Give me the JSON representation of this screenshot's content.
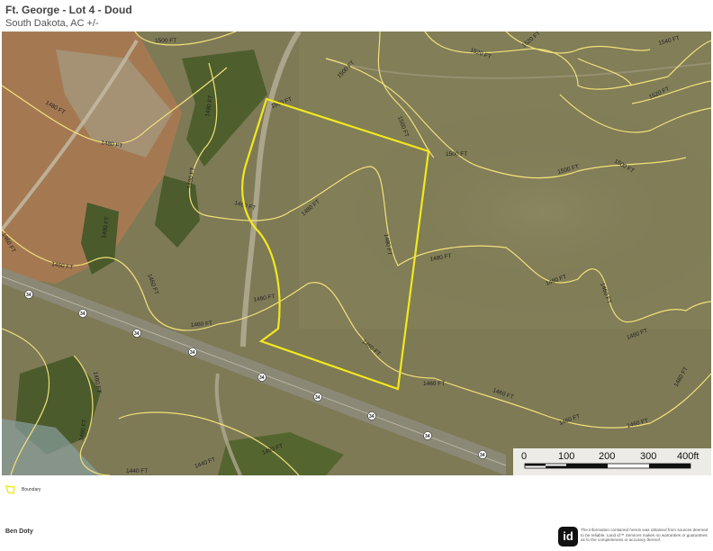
{
  "header": {
    "title": "Ft. George - Lot 4 - Doud",
    "subtitle": "South Dakota,  AC +/-"
  },
  "map": {
    "highway_number": "34",
    "contour_labels": [
      "1500 FT",
      "1500 FT",
      "1540 FT",
      "1520 FT",
      "1520 FT",
      "1520 FT",
      "1480 FT",
      "1480 FT",
      "1500 FT",
      "1500 FT",
      "1480 FT",
      "1500 FT",
      "1500 FT",
      "1500 FT",
      "1480 FT",
      "1460 FT",
      "1480 FT",
      "1460 FT",
      "1480 FT",
      "1480 FT",
      "1460 FT",
      "1480 FT",
      "1460 FT",
      "1460 FT",
      "1480 FT",
      "1460 FT",
      "1460 FT",
      "1480 FT",
      "1460 FT",
      "1460 FT",
      "1460 FT",
      "1460 FT",
      "1460 FT",
      "1440 FT",
      "1440 FT",
      "1460 FT",
      "1460 FT",
      "1460 FT",
      "1460 FT"
    ],
    "colors": {
      "boundary": "#f2e81e",
      "contour": "#f2e17a",
      "imagery": "#7d7a55"
    },
    "scale": {
      "labels": [
        "0",
        "100",
        "200",
        "300",
        "400ft"
      ]
    }
  },
  "legend": {
    "boundary_label": "Boundary"
  },
  "footer": {
    "author": "Ben Doty",
    "logo_text": "id",
    "disclaimer": "The information contained herein was obtained from sources deemed to be reliable. Land id™ Services makes no warranties or guarantees as to the completeness or accuracy thereof."
  }
}
